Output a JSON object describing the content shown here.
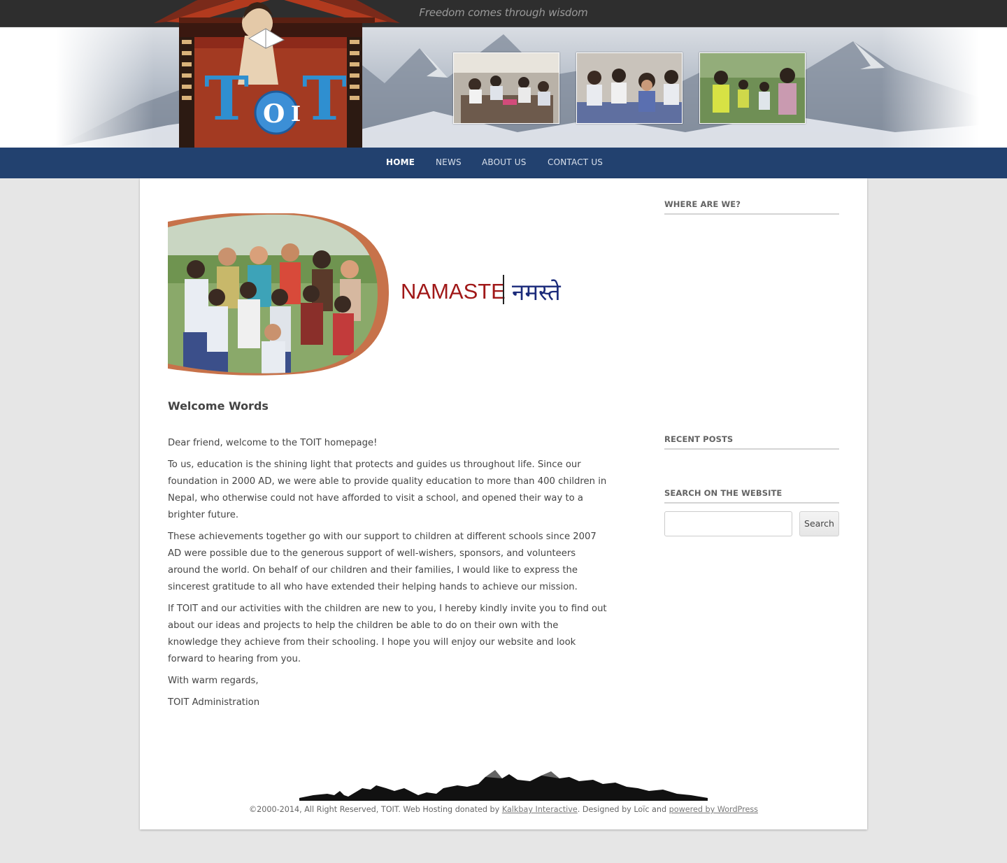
{
  "header": {
    "tagline": "Freedom comes through wisdom",
    "logo_text": "TOIT"
  },
  "nav": {
    "items": [
      {
        "label": "Home",
        "active": true
      },
      {
        "label": "News"
      },
      {
        "label": "About Us"
      },
      {
        "label": "Contact Us"
      }
    ]
  },
  "hero": {
    "namaste_latin": "NAMASTE",
    "namaste_devanagari": "नमस्ते"
  },
  "article": {
    "title": "Welcome Words",
    "paragraphs": [
      "Dear friend, welcome to the TOIT homepage!",
      "To us, education is the shining light that protects and guides us throughout life. Since our foundation in 2000 AD, we were able to provide quality education to more than 400 children in Nepal, who otherwise could not have afforded to visit a school, and opened their way to a brighter future.",
      "These achievements together go with our support to children at different schools since 2007 AD were possible due to the generous support of well-wishers, sponsors, and volunteers around the world. On behalf of our children and their families, I would like to express the sincerest gratitude to all who have extended their helping hands to achieve our mission.",
      "If TOIT and our activities with the children are new to you, I hereby kindly invite you to find out about our ideas and projects to help the children be able to do on their own with the knowledge they achieve from their schooling. I hope you will enjoy our website and look forward to hearing from you.",
      "With warm regards,",
      "TOIT Administration"
    ]
  },
  "sidebar": {
    "where_title": "Where are we?",
    "recent_title": "Recent Posts",
    "search_title": "Search on the website",
    "search_value": "",
    "search_button": "Search"
  },
  "footer": {
    "text_before": "©2000-2014, All Right Reserved, TOIT. Web Hosting donated by ",
    "link1": "Kalkbay Interactive",
    "text_middle": ". Designed by Loïc and ",
    "link2": "powered by WordPress"
  },
  "colors": {
    "nav_bg": "#22416f",
    "topbar_bg": "#2e2e2e",
    "namaste_red": "#a01818",
    "namaste_blue": "#1a2a7a"
  }
}
